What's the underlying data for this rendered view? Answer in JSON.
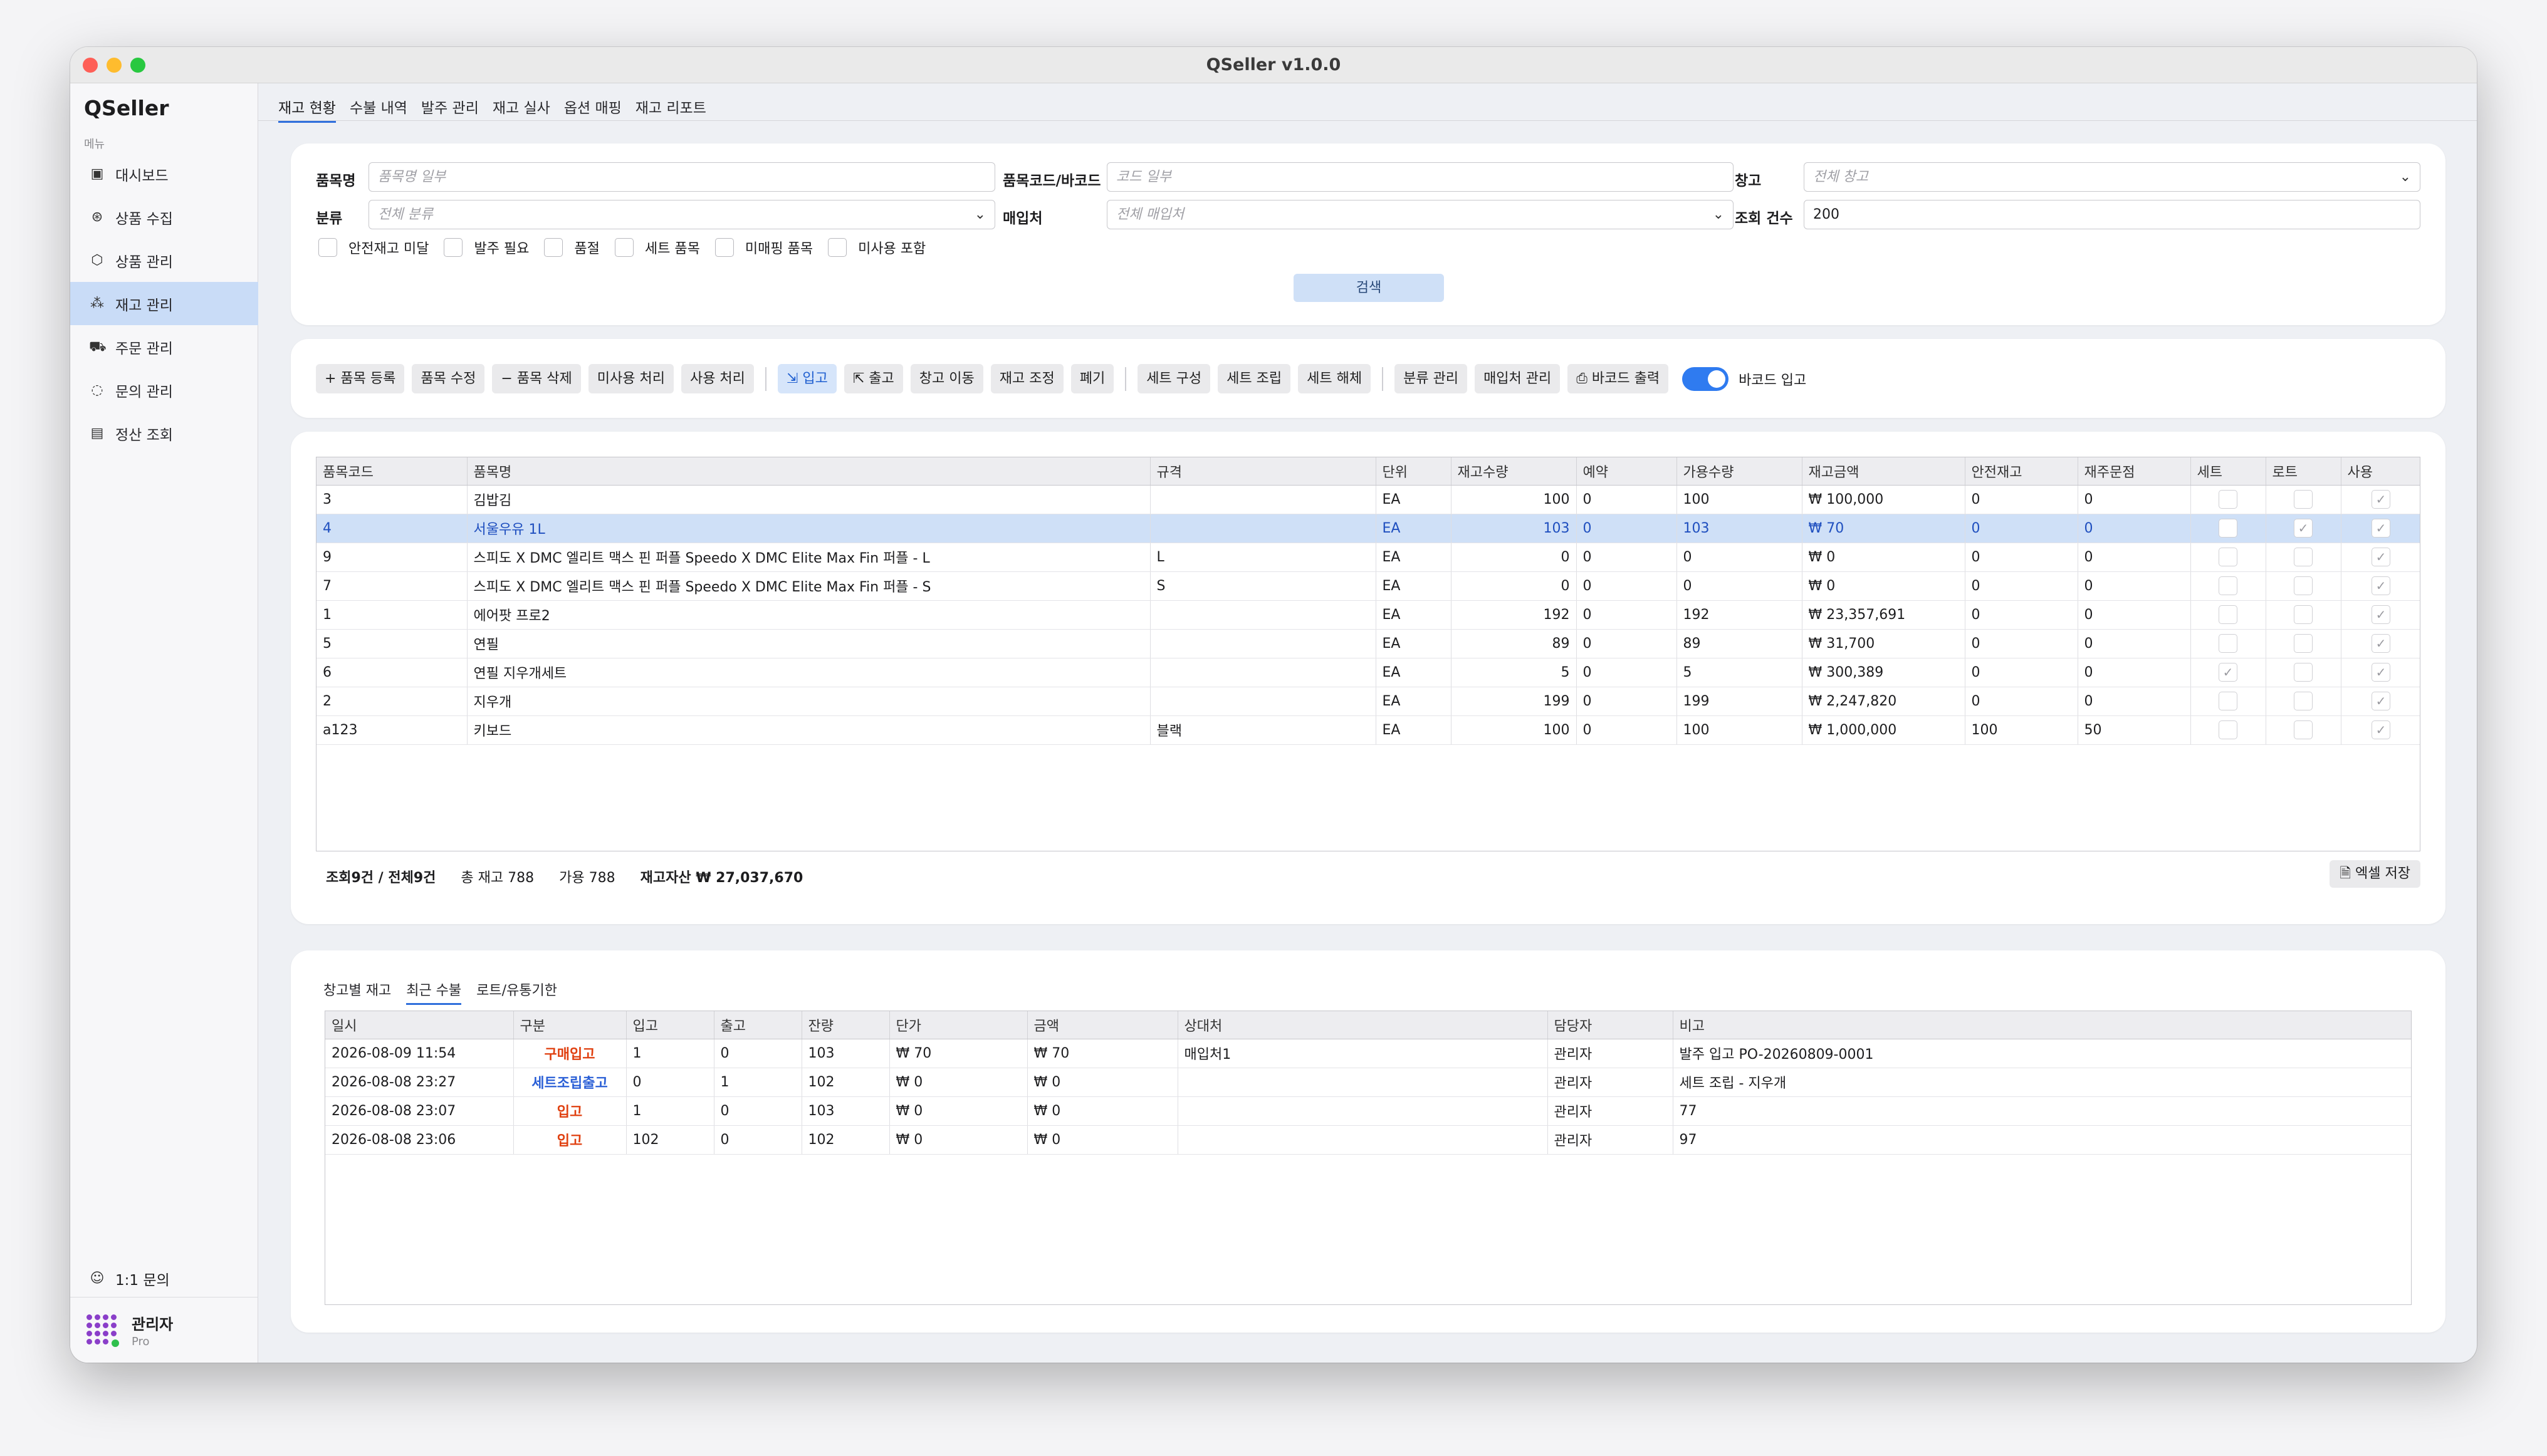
{
  "window": {
    "title": "QSeller v1.0.0"
  },
  "sidebar": {
    "brand": "QSeller",
    "menu_caption": "메뉴",
    "items": [
      {
        "label": "대시보드",
        "icon": "dashboard-icon"
      },
      {
        "label": "상품 수집",
        "icon": "collect-icon"
      },
      {
        "label": "상품 관리",
        "icon": "box-icon"
      },
      {
        "label": "재고 관리",
        "icon": "boxes-icon"
      },
      {
        "label": "주문 관리",
        "icon": "truck-icon"
      },
      {
        "label": "문의 관리",
        "icon": "chat-icon"
      },
      {
        "label": "정산 조회",
        "icon": "receipt-icon"
      }
    ],
    "inquiry": "1:1 문의",
    "user": {
      "name": "관리자",
      "plan": "Pro"
    }
  },
  "tabs": [
    "재고 현황",
    "수불 내역",
    "발주 관리",
    "재고 실사",
    "옵션 매핑",
    "재고 리포트"
  ],
  "filters": {
    "name_label": "품목명",
    "name_placeholder": "품목명 일부",
    "code_label": "품목코드/바코드",
    "code_placeholder": "코드 일부",
    "warehouse_label": "창고",
    "warehouse_value": "전체 창고",
    "category_label": "분류",
    "category_value": "전체 분류",
    "supplier_label": "매입처",
    "supplier_value": "전체 매입처",
    "count_label": "조회 건수",
    "count_value": "200",
    "checkboxes": [
      "안전재고 미달",
      "발주 필요",
      "품절",
      "세트 품목",
      "미매핑 품목",
      "미사용 포함"
    ],
    "search_button": "검색"
  },
  "toolbar": {
    "group1": [
      "+ 품목 등록",
      "품목 수정",
      "− 품목 삭제",
      "미사용 처리",
      "사용 처리"
    ],
    "group2": [
      "입고",
      "출고",
      "창고 이동",
      "재고 조정",
      "폐기"
    ],
    "group3": [
      "세트 구성",
      "세트 조립",
      "세트 해체"
    ],
    "group4": [
      "분류 관리",
      "매입처 관리",
      "바코드 출력"
    ],
    "barcode_toggle": "바코드 입고"
  },
  "inventory": {
    "columns": [
      "품목코드",
      "품목명",
      "규격",
      "단위",
      "재고수량",
      "예약",
      "가용수량",
      "재고금액",
      "안전재고",
      "재주문점",
      "세트",
      "로트",
      "사용"
    ],
    "rows": [
      {
        "code": "3",
        "name": "김밥김",
        "spec": "",
        "unit": "EA",
        "qty": "100",
        "reserved": "0",
        "avail": "100",
        "amount": "₩ 100,000",
        "safety": "0",
        "reorder": "0",
        "set": false,
        "lot": false,
        "use": true
      },
      {
        "code": "4",
        "name": "서울우유 1L",
        "spec": "",
        "unit": "EA",
        "qty": "103",
        "reserved": "0",
        "avail": "103",
        "amount": "₩ 70",
        "safety": "0",
        "reorder": "0",
        "set": false,
        "lot": true,
        "use": true
      },
      {
        "code": "9",
        "name": "스피도 X DMC 엘리트 맥스 핀 퍼플 Speedo X DMC Elite Max Fin 퍼플 - L",
        "spec": "L",
        "unit": "EA",
        "qty": "0",
        "reserved": "0",
        "avail": "0",
        "amount": "₩ 0",
        "safety": "0",
        "reorder": "0",
        "set": false,
        "lot": false,
        "use": true
      },
      {
        "code": "7",
        "name": "스피도 X DMC 엘리트 맥스 핀 퍼플 Speedo X DMC Elite Max Fin 퍼플 - S",
        "spec": "S",
        "unit": "EA",
        "qty": "0",
        "reserved": "0",
        "avail": "0",
        "amount": "₩ 0",
        "safety": "0",
        "reorder": "0",
        "set": false,
        "lot": false,
        "use": true
      },
      {
        "code": "1",
        "name": "에어팟 프로2",
        "spec": "",
        "unit": "EA",
        "qty": "192",
        "reserved": "0",
        "avail": "192",
        "amount": "₩ 23,357,691",
        "safety": "0",
        "reorder": "0",
        "set": false,
        "lot": false,
        "use": true
      },
      {
        "code": "5",
        "name": "연필",
        "spec": "",
        "unit": "EA",
        "qty": "89",
        "reserved": "0",
        "avail": "89",
        "amount": "₩ 31,700",
        "safety": "0",
        "reorder": "0",
        "set": false,
        "lot": false,
        "use": true
      },
      {
        "code": "6",
        "name": "연필 지우개세트",
        "spec": "",
        "unit": "EA",
        "qty": "5",
        "reserved": "0",
        "avail": "5",
        "amount": "₩ 300,389",
        "safety": "0",
        "reorder": "0",
        "set": true,
        "lot": false,
        "use": true
      },
      {
        "code": "2",
        "name": "지우개",
        "spec": "",
        "unit": "EA",
        "qty": "199",
        "reserved": "0",
        "avail": "199",
        "amount": "₩ 2,247,820",
        "safety": "0",
        "reorder": "0",
        "set": false,
        "lot": false,
        "use": true
      },
      {
        "code": "a123",
        "name": "키보드",
        "spec": "블랙",
        "unit": "EA",
        "qty": "100",
        "reserved": "0",
        "avail": "100",
        "amount": "₩ 1,000,000",
        "safety": "100",
        "reorder": "50",
        "set": false,
        "lot": false,
        "use": true
      }
    ],
    "selected_index": 1,
    "summary": {
      "count": "조회9건 / 전체9건",
      "total": "총 재고 788",
      "avail": "가용 788",
      "asset": "재고자산 ₩ 27,037,670"
    },
    "excel_button": "엑셀 저장"
  },
  "bottom": {
    "tabs": [
      "창고별 재고",
      "최근 수불",
      "로트/유통기한"
    ],
    "active_tab": 1,
    "columns": [
      "일시",
      "구분",
      "입고",
      "출고",
      "잔량",
      "단가",
      "금액",
      "상대처",
      "담당자",
      "비고"
    ],
    "rows": [
      {
        "date": "2026-08-09 11:54",
        "type": "구매입고",
        "color": "#e04010",
        "in": "1",
        "out": "0",
        "bal": "103",
        "price": "₩ 70",
        "amount": "₩ 70",
        "partner": "매입처1",
        "staff": "관리자",
        "note": "발주 입고 PO-20260809-0001"
      },
      {
        "date": "2026-08-08 23:27",
        "type": "세트조립출고",
        "color": "#2a5fd6",
        "in": "0",
        "out": "1",
        "bal": "102",
        "price": "₩ 0",
        "amount": "₩ 0",
        "partner": "",
        "staff": "관리자",
        "note": "세트 조립 - 지우개"
      },
      {
        "date": "2026-08-08 23:07",
        "type": "입고",
        "color": "#e04010",
        "in": "1",
        "out": "0",
        "bal": "103",
        "price": "₩ 0",
        "amount": "₩ 0",
        "partner": "",
        "staff": "관리자",
        "note": "77"
      },
      {
        "date": "2026-08-08 23:06",
        "type": "입고",
        "color": "#e04010",
        "in": "102",
        "out": "0",
        "bal": "102",
        "price": "₩ 0",
        "amount": "₩ 0",
        "partner": "",
        "staff": "관리자",
        "note": "97"
      }
    ]
  }
}
